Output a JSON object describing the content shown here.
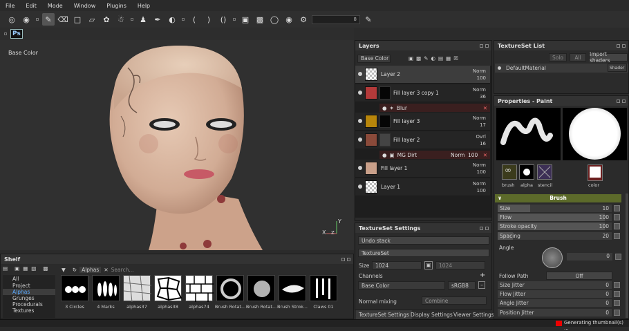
{
  "menu": [
    "File",
    "Edit",
    "Mode",
    "Window",
    "Plugins",
    "Help"
  ],
  "toolbar": {
    "slider_value": "8",
    "ps_label": "Ps"
  },
  "viewport": {
    "label": "Base Color"
  },
  "layers": {
    "title": "Layers",
    "channel": "Base Color",
    "items": [
      {
        "name": "Layer 2",
        "blend": "Norm",
        "opacity": "100"
      },
      {
        "name": "Fill layer 3 copy 1",
        "blend": "Norm",
        "opacity": "36"
      },
      {
        "name": "Fill layer 3",
        "blend": "Norm",
        "opacity": "17"
      },
      {
        "name": "Fill layer 2",
        "blend": "Ovrl",
        "opacity": "16"
      },
      {
        "name": "Fill layer 1",
        "blend": "Norm",
        "opacity": "100"
      },
      {
        "name": "Layer 1",
        "blend": "Norm",
        "opacity": "100"
      }
    ],
    "effects": [
      {
        "name": "Blur"
      },
      {
        "name": "MG Dirt",
        "blend": "Norm",
        "opacity": "100"
      }
    ]
  },
  "textureset_list": {
    "title": "TextureSet List",
    "buttons": [
      "Solo",
      "All",
      "Import shaders"
    ],
    "material": "DefaultMaterial",
    "shader": "Shader"
  },
  "properties": {
    "title": "Properties - Paint",
    "slots": [
      "brush",
      "alpha",
      "stencil",
      "color"
    ],
    "section": "Brush",
    "rows": [
      {
        "label": "Size",
        "value": "10"
      },
      {
        "label": "Flow",
        "value": "100"
      },
      {
        "label": "Stroke opacity",
        "value": "100"
      },
      {
        "label": "Spacing",
        "value": "20"
      }
    ],
    "angle_label": "Angle",
    "angle_value": "0",
    "follow_path_label": "Follow Path",
    "follow_path_value": "Off",
    "jitter": [
      {
        "label": "Size Jitter",
        "value": "0"
      },
      {
        "label": "Flow Jitter",
        "value": "0"
      },
      {
        "label": "Angle Jitter",
        "value": "0"
      },
      {
        "label": "Position Jitter",
        "value": "0"
      }
    ]
  },
  "textureset_settings": {
    "title": "TextureSet Settings",
    "undo_stack": "Undo stack",
    "textureset": "TextureSet",
    "size_label": "Size",
    "size_value": "1024",
    "size_value2": "1024",
    "channels_label": "Channels",
    "channel_name": "Base Color",
    "channel_format": "sRGB8",
    "normal_mixing_label": "Normal mixing",
    "normal_mixing_value": "Combine"
  },
  "bottom_tabs": [
    "TextureSet Settings",
    "Display Settings",
    "Viewer Settings"
  ],
  "shelf": {
    "title": "Shelf",
    "categories": [
      "All",
      "Project",
      "Alphas",
      "Grunges",
      "Procedurals",
      "Textures"
    ],
    "selected_category": "Alphas",
    "filter_tag": "Alphas",
    "search_placeholder": "Search...",
    "items": [
      "3 Circles",
      "4 Marks",
      "alphas37",
      "alphas38",
      "alphas74",
      "Brush Rotat...",
      "Brush Rotat...",
      "Brush Strok...",
      "Claws 01"
    ]
  },
  "status": {
    "text": "Generating thumbnail(s) ..."
  }
}
